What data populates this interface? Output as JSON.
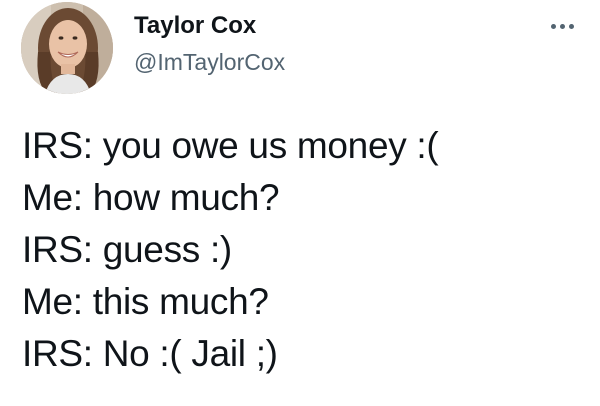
{
  "tweet": {
    "author": {
      "display_name": "Taylor Cox",
      "handle": "@ImTaylorCox",
      "avatar_icon": "profile-photo-avatar"
    },
    "more_icon": "more-options-ellipsis-icon",
    "lines": [
      "IRS: you owe us money :(",
      "Me: how much?",
      "IRS: guess :)",
      "Me: this much?",
      "IRS: No :( Jail ;)"
    ]
  },
  "colors": {
    "text_primary": "#0f1419",
    "text_secondary": "#536471",
    "background": "#ffffff"
  }
}
